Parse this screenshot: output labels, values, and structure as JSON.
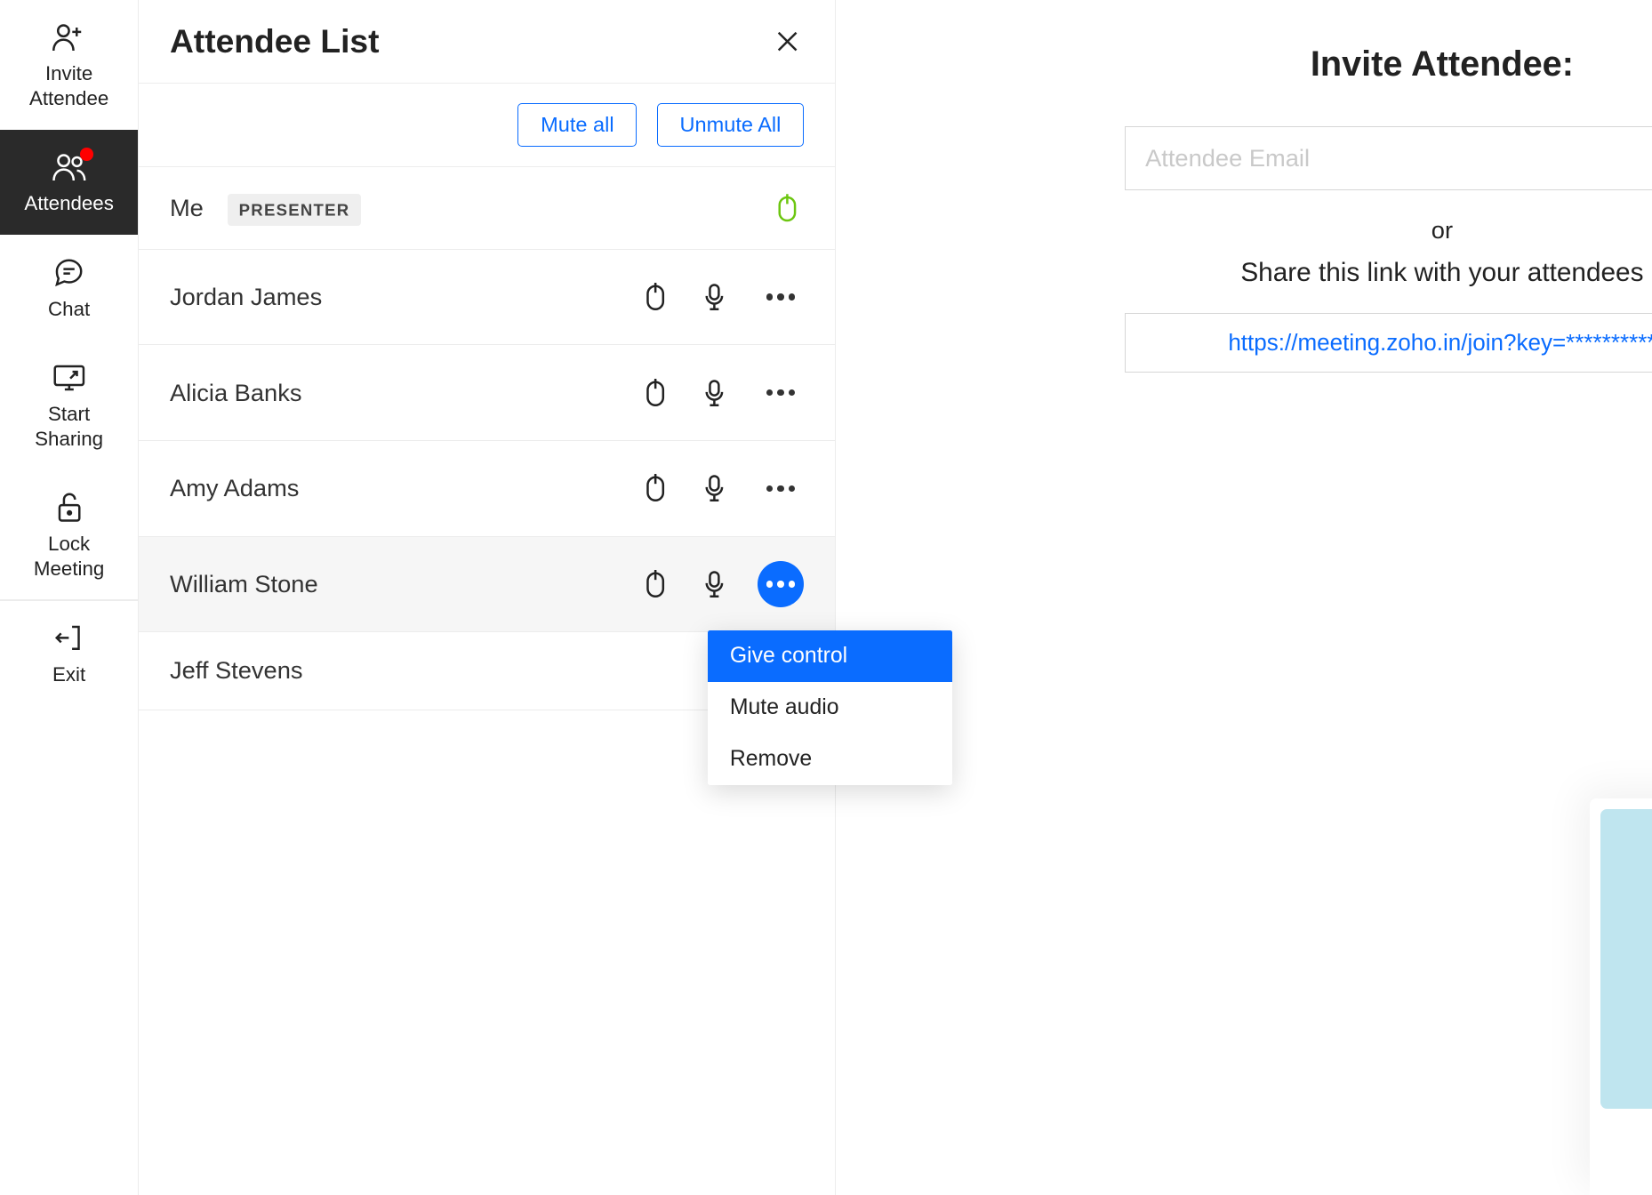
{
  "sidebar": {
    "items": [
      {
        "label": "Invite\nAttendee",
        "icon": "person-plus-icon"
      },
      {
        "label": "Attendees",
        "icon": "people-icon",
        "active": true,
        "badge": true
      },
      {
        "label": "Chat",
        "icon": "chat-icon"
      },
      {
        "label": "Start\nSharing",
        "icon": "screen-share-icon"
      },
      {
        "label": "Lock\nMeeting",
        "icon": "unlock-icon"
      },
      {
        "label": "Exit",
        "icon": "exit-icon"
      }
    ]
  },
  "panel": {
    "title": "Attendee List",
    "mute_all": "Mute all",
    "unmute_all": "Unmute All",
    "presenter_badge": "PRESENTER",
    "me_label": "Me",
    "attendees": [
      {
        "name": "Jordan James"
      },
      {
        "name": "Alicia Banks"
      },
      {
        "name": "Amy Adams"
      },
      {
        "name": "William Stone",
        "menu_open": true,
        "highlight": true
      },
      {
        "name": "Jeff Stevens"
      }
    ],
    "menu": {
      "give_control": "Give control",
      "mute_audio": "Mute audio",
      "remove": "Remove"
    }
  },
  "invite": {
    "title": "Invite Attendee:",
    "placeholder": "Attendee Email",
    "or": "or",
    "share_text": "Share this link with your attendees",
    "share_link": "https://meeting.zoho.in/join?key=**********"
  },
  "video_controls": {
    "mic": "microphone-icon",
    "cam": "video-icon",
    "call": "answer-call-icon"
  }
}
